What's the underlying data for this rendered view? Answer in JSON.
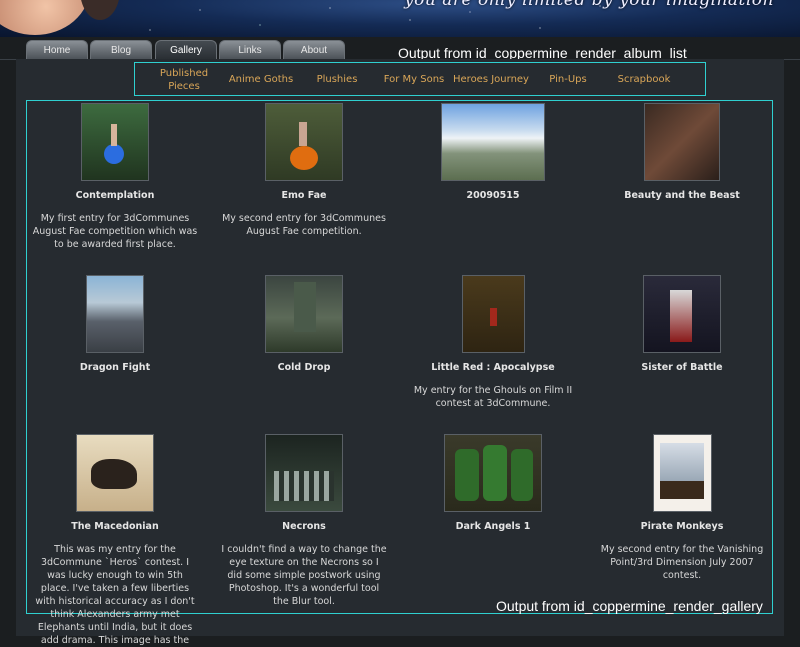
{
  "banner": {
    "tagline": "you are only limited by your imagination"
  },
  "nav": {
    "tabs": [
      {
        "label": "Home"
      },
      {
        "label": "Blog"
      },
      {
        "label": "Gallery",
        "active": true
      },
      {
        "label": "Links"
      },
      {
        "label": "About"
      }
    ]
  },
  "annotations": {
    "album_list": "Output from id_coppermine_render_album_list",
    "gallery": "Output from id_coppermine_render_gallery"
  },
  "albums": [
    {
      "label": "Published Pieces"
    },
    {
      "label": "Anime Goths"
    },
    {
      "label": "Plushies"
    },
    {
      "label": "For My Sons"
    },
    {
      "label": "Heroes Journey"
    },
    {
      "label": "Pin-Ups"
    },
    {
      "label": "Scrapbook"
    }
  ],
  "colors": {
    "accent": "#2fd0d0",
    "link": "#d9a658"
  },
  "gallery": [
    {
      "title": "Contemplation",
      "desc": "My first entry for 3dCommunes August Fae competition which was to be awarded first place.",
      "icon": "fairy-image-icon"
    },
    {
      "title": "Emo Fae",
      "desc": "My second entry for 3dCommunes August Fae competition.",
      "icon": "pumpkin-fae-image-icon"
    },
    {
      "title": "20090515",
      "desc": "",
      "icon": "mountain-landscape-image-icon"
    },
    {
      "title": "Beauty and the Beast",
      "desc": "",
      "icon": "beast-image-icon"
    },
    {
      "title": "Dragon Fight",
      "desc": "",
      "icon": "dragon-image-icon"
    },
    {
      "title": "Cold Drop",
      "desc": "",
      "icon": "spaceship-image-icon"
    },
    {
      "title": "Little Red : Apocalypse",
      "desc": "My entry for the Ghouls on Film II contest at 3dCommune.",
      "icon": "poster-image-icon"
    },
    {
      "title": "Sister of Battle",
      "desc": "",
      "icon": "warrior-image-icon"
    },
    {
      "title": "The Macedonian",
      "desc": "This was my entry for the 3dCommune `Heros` contest. I was lucky enough to win 5th place. I've taken a few liberties with historical accuracy as I don't think Alexanders army met Elephants until India, but it does add drama. This image has the",
      "icon": "horse-rider-image-icon"
    },
    {
      "title": "Necrons",
      "desc": "I couldn't find a way to change the eye texture on the Necrons so I did some simple postwork using Photoshop. It's a wonderful tool the Blur tool.",
      "icon": "robots-image-icon"
    },
    {
      "title": "Dark Angels 1",
      "desc": "",
      "icon": "space-marines-image-icon"
    },
    {
      "title": "Pirate Monkeys",
      "desc": "My second entry for the Vanishing Point/3rd Dimension July 2007 contest.",
      "icon": "pirate-ship-image-icon"
    }
  ]
}
